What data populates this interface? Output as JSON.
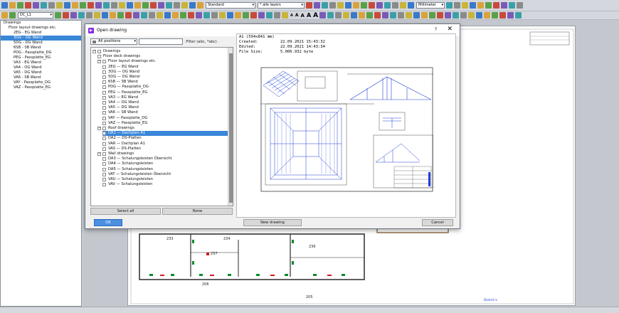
{
  "toolbar": {
    "style_combo": "Standard",
    "layer_combo": "* alle layers",
    "unit_combo": "Millimeter",
    "drawing_combo": "DC_L1",
    "text_size_labels": [
      "A",
      "A",
      "A",
      "A",
      "A"
    ]
  },
  "tree": {
    "items": [
      {
        "label": "Drawings",
        "indent": 0
      },
      {
        "label": "Floor layout drawings etc.",
        "indent": 1
      },
      {
        "label": "2EG - EG Wand",
        "indent": 2
      },
      {
        "label": "3OG - OG Wand",
        "indent": 2,
        "selected": true
      },
      {
        "label": "5DG - DG Wand",
        "indent": 2
      },
      {
        "label": "6SB - SB Wand",
        "indent": 2
      },
      {
        "label": "PDG - Passplatte_DG",
        "indent": 2
      },
      {
        "label": "PEG - Passplatte_EG",
        "indent": 2
      },
      {
        "label": "VA3 - EG Wand",
        "indent": 2
      },
      {
        "label": "VA4 - OG Wand",
        "indent": 2
      },
      {
        "label": "VA5 - DG Wand",
        "indent": 2
      },
      {
        "label": "VA6 - SB Wand",
        "indent": 2
      },
      {
        "label": "VAY - Passplatte_DG",
        "indent": 2
      },
      {
        "label": "VAZ - Passplatte_EG",
        "indent": 2
      }
    ]
  },
  "dialog": {
    "title": "Open drawing",
    "help_symbol": "?",
    "close_symbol": "✕",
    "filter_mode": "All positions",
    "filter_value": "",
    "filter_label": ":Filter (abc, *abc)",
    "list": [
      {
        "label": "Drawings",
        "level": 0,
        "type": "group",
        "expander": "−"
      },
      {
        "label": "Floor deck drawings",
        "level": 1,
        "type": "group"
      },
      {
        "label": "Floor layout drawings etc.",
        "level": 1,
        "type": "group",
        "expander": "−"
      },
      {
        "label": "2EG — EG Wand",
        "level": 2
      },
      {
        "label": "3OG — OG Wand",
        "level": 2
      },
      {
        "label": "5DG — DG Wand",
        "level": 2
      },
      {
        "label": "6SB — SB Wand",
        "level": 2
      },
      {
        "label": "PDG — Passplatte_DG",
        "level": 2
      },
      {
        "label": "PEG — Passplatte_EG",
        "level": 2
      },
      {
        "label": "VA3 — EG Wand",
        "level": 2
      },
      {
        "label": "VA4 — OG Wand",
        "level": 2
      },
      {
        "label": "VA5 — DG Wand",
        "level": 2
      },
      {
        "label": "VA6 — SB Wand",
        "level": 2
      },
      {
        "label": "VAY — Passplatte_DG",
        "level": 2
      },
      {
        "label": "VAZ — Passplatte_EG",
        "level": 2
      },
      {
        "label": "Roof drawings",
        "level": 1,
        "type": "group",
        "expander": "−"
      },
      {
        "label": "DA1 — Dachplan A1",
        "level": 2,
        "selected": true
      },
      {
        "label": "DA2 — DS-Platten",
        "level": 2
      },
      {
        "label": "VAR — Dachplan A1",
        "level": 2
      },
      {
        "label": "VAS — DS-Platten",
        "level": 2
      },
      {
        "label": "Wall drawings",
        "level": 1,
        "type": "group",
        "expander": "−"
      },
      {
        "label": "DA3 — Schalungsleisten Übersicht",
        "level": 2
      },
      {
        "label": "DA4 — Schalungsleisten",
        "level": 2
      },
      {
        "label": "DA5 — Schalungsleisten",
        "level": 2
      },
      {
        "label": "VAT — Schalungsleisten Übersicht",
        "level": 2
      },
      {
        "label": "VAU — Schalungsleisten",
        "level": 2
      },
      {
        "label": "VAV — Schalungsleisten",
        "level": 2
      }
    ],
    "select_all_label": "Select all",
    "none_label": "None",
    "ok_label": "OK",
    "new_drawing_label": "New drawing",
    "cancel_label": "Cancel",
    "preview": {
      "format": "A1 (594x841 mm)",
      "created_label": "Created:",
      "created_value": "22.09.2021 15:43:32",
      "edited_label": "Edited:",
      "edited_value": "22.09.2021 14:43:34",
      "size_label": "File Size:",
      "size_value": "5.006.932 byte"
    }
  },
  "background_plan": {
    "room_labels": [
      "233",
      "234",
      "236",
      "237",
      "206",
      "205"
    ],
    "dimension_label": "812",
    "footer_text": "Dietrich's"
  },
  "colors": {
    "selection": "#3a86d8",
    "accent_purple": "#8a2be2",
    "drawing_blue": "#1f3fd6"
  }
}
